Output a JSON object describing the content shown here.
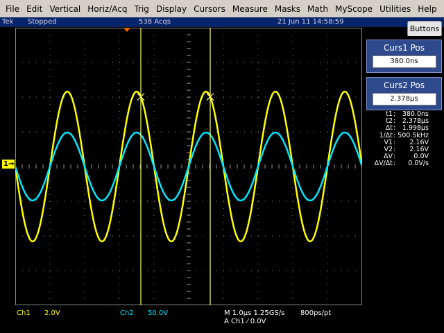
{
  "menu": [
    "File",
    "Edit",
    "Vertical",
    "Horiz/Acq",
    "Trig",
    "Display",
    "Cursors",
    "Measure",
    "Masks",
    "Math",
    "MyScope",
    "Utilities",
    "Help"
  ],
  "status": {
    "brand": "Tek",
    "state": "Stopped",
    "acqs": "538 Acqs",
    "datetime": "21 Jun 11 14:58:59"
  },
  "buttons_label": "Buttons",
  "curs1": {
    "title": "Curs1 Pos",
    "value": "380.0ns"
  },
  "curs2": {
    "title": "Curs2 Pos",
    "value": "2.378μs"
  },
  "readout": [
    {
      "label": "t1",
      "value": "380.0ns"
    },
    {
      "label": "t2",
      "value": "2.378μs"
    },
    {
      "label": "Δt",
      "value": "1.998μs"
    },
    {
      "label": "1/Δt",
      "value": "500.5kHz"
    },
    {
      "label": "V1",
      "value": "2.16V"
    },
    {
      "label": "V2",
      "value": "2.16V"
    },
    {
      "label": "ΔV",
      "value": "0.0V"
    },
    {
      "label": "ΔV/Δt",
      "value": "0.0V/s"
    }
  ],
  "channel_marker": "1",
  "bottom": {
    "ch1_label": "Ch1",
    "ch1_scale": "2.0V",
    "ch2_label": "Ch2",
    "ch2_scale": "50.0V",
    "timebase": "M 1.0μs 1.25GS/s",
    "resolution": "800ps/pt",
    "trigger": "A  Ch1  ⁄  0.0V"
  },
  "colors": {
    "ch1": "#ffff00",
    "ch2": "#00e8ff",
    "grid": "#8a8a8a",
    "cursor": "#ffff66"
  },
  "chart_data": {
    "type": "line",
    "xlim": [
      0,
      10
    ],
    "ylim": [
      -4,
      4
    ],
    "grid": true,
    "series": [
      {
        "name": "Ch1",
        "amplitude": 2.16,
        "period": 2.0,
        "phase_offset": 0.0
      },
      {
        "name": "Ch2",
        "amplitude": 0.98,
        "period": 2.0,
        "phase_offset": 0.0
      }
    ],
    "cursors": [
      3.62,
      5.62
    ]
  }
}
